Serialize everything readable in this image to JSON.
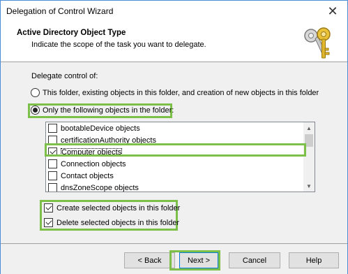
{
  "window": {
    "title": "Delegation of Control Wizard"
  },
  "header": {
    "title": "Active Directory Object Type",
    "subtitle": "Indicate the scope of the task you want to delegate."
  },
  "content": {
    "delegate_label": "Delegate control of:",
    "radio_this_folder": "This folder, existing objects in this folder, and creation of new objects in this folder",
    "radio_only_following": "Only the following objects in the folder:",
    "object_list": [
      {
        "label": "bootableDevice objects",
        "checked": false
      },
      {
        "label": "certificationAuthority objects",
        "checked": false
      },
      {
        "label": "Computer objects",
        "checked": true
      },
      {
        "label": "Connection objects",
        "checked": false
      },
      {
        "label": "Contact objects",
        "checked": false
      },
      {
        "label": "dnsZoneScope objects",
        "checked": false
      }
    ],
    "create_selected": "Create selected objects in this folder",
    "delete_selected": "Delete selected objects in this folder"
  },
  "buttons": {
    "back": "< Back",
    "next": "Next >",
    "cancel": "Cancel",
    "help": "Help"
  },
  "colors": {
    "highlight": "#7cc04a",
    "accent": "#0078d7"
  }
}
